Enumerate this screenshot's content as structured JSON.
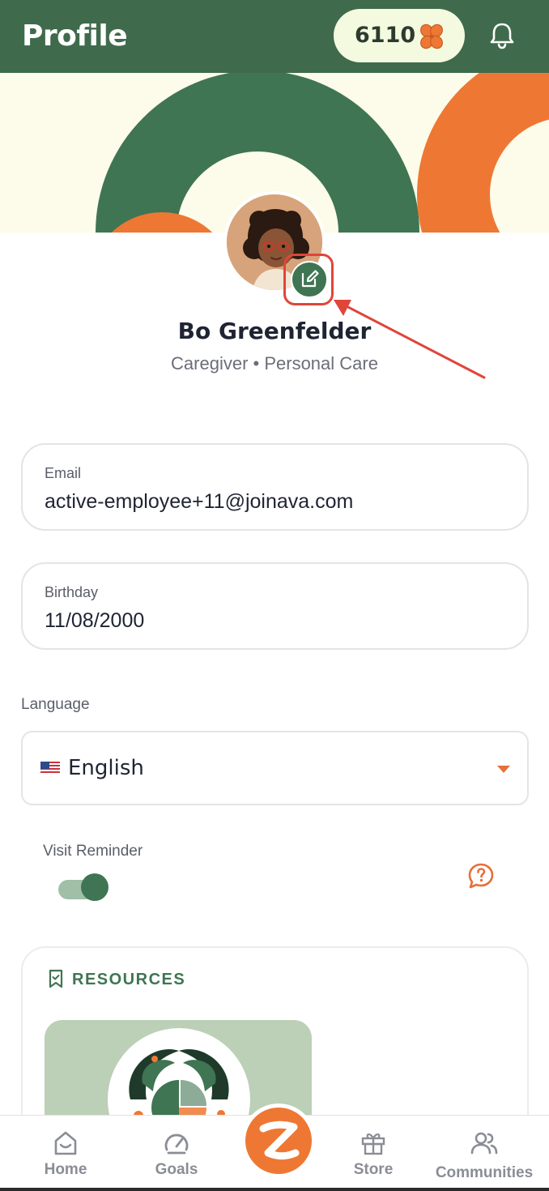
{
  "header": {
    "title": "Profile",
    "points": "6110",
    "points_icon": "clover-icon",
    "notification_icon": "bell-icon"
  },
  "profile": {
    "name": "Bo Greenfelder",
    "subtitle": "Caregiver • Personal Care",
    "edit_icon": "edit-icon"
  },
  "fields": {
    "email": {
      "label": "Email",
      "value": "active-employee+11@joinava.com"
    },
    "birthday": {
      "label": "Birthday",
      "value": "11/08/2000"
    }
  },
  "language": {
    "label": "Language",
    "selected": "English",
    "flag_icon": "us-flag-icon"
  },
  "visit_reminder": {
    "label": "Visit Reminder",
    "enabled": true,
    "help_icon": "help-chat-icon"
  },
  "resources": {
    "title": "RESOURCES",
    "icon": "bookmark-icon"
  },
  "bottom_nav": {
    "items": [
      {
        "label": "Home",
        "icon": "home-icon"
      },
      {
        "label": "Goals",
        "icon": "gauge-icon"
      },
      {
        "label": "",
        "icon": "z-logo-icon"
      },
      {
        "label": "Store",
        "icon": "gift-icon"
      },
      {
        "label": "Communities",
        "icon": "people-icon"
      }
    ]
  },
  "colors": {
    "primary_green": "#3f6b4c",
    "accent_orange": "#ee7833",
    "highlight_red": "#e0453a"
  }
}
